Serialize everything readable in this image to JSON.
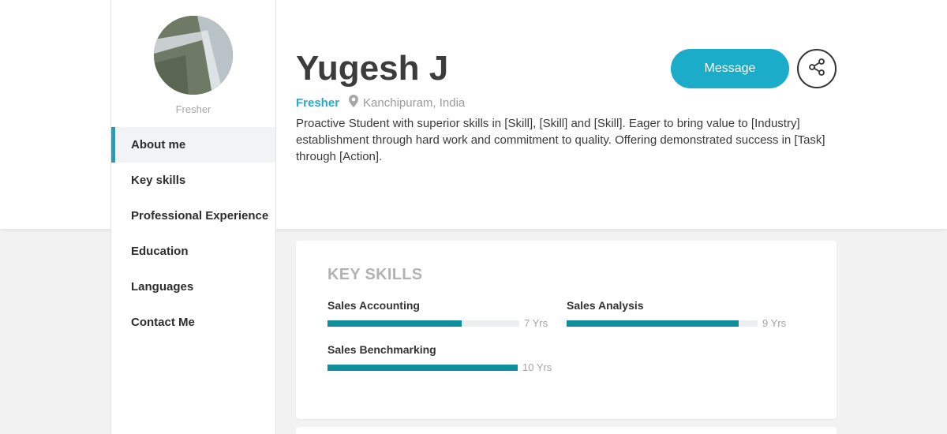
{
  "profile": {
    "role": "Fresher",
    "name": "Yugesh J",
    "status": "Fresher",
    "location": "Kanchipuram, India",
    "bio": "Proactive Student with superior skills in [Skill], [Skill] and [Skill]. Eager to bring value to [Industry] establishment through hard work and commitment to quality. Offering demonstrated success in [Task] through [Action]."
  },
  "actions": {
    "message_label": "Message",
    "share_icon": "share-icon"
  },
  "sidebar": {
    "items": [
      {
        "label": "About me",
        "active": true
      },
      {
        "label": "Key skills"
      },
      {
        "label": "Professional Experience"
      },
      {
        "label": "Education"
      },
      {
        "label": "Languages"
      },
      {
        "label": "Contact Me"
      }
    ]
  },
  "key_skills": {
    "title": "KEY SKILLS",
    "items": [
      {
        "name": "Sales Accounting",
        "years": "7 Yrs",
        "level_fraction": 0.7
      },
      {
        "name": "Sales Analysis",
        "years": "9 Yrs",
        "level_fraction": 0.9
      },
      {
        "name": "Sales Benchmarking",
        "years": "10 Yrs",
        "level_fraction": 1.0
      }
    ]
  },
  "colors": {
    "accent": "#1aacc8",
    "bar": "#0e8f9b",
    "status_text": "#2aa8c6"
  }
}
